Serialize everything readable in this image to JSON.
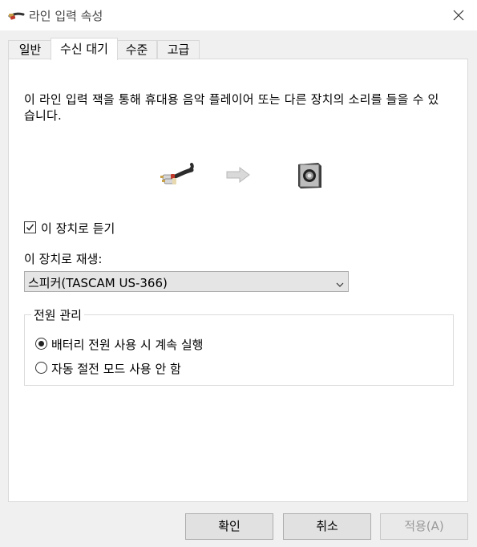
{
  "window": {
    "title": "라인 입력 속성",
    "icon": "line-in-cable-icon",
    "close_icon": "close-icon"
  },
  "tabs": [
    {
      "label": "일반",
      "active": false
    },
    {
      "label": "수신 대기",
      "active": true
    },
    {
      "label": "수준",
      "active": false
    },
    {
      "label": "고급",
      "active": false
    }
  ],
  "listen": {
    "description": "이 라인 입력 잭을 통해 휴대용 음악 플레이어 또는 다른 장치의 소리를 들을 수 있습니다.",
    "checkbox_label": "이 장치로 듣기",
    "checkbox_checked": true,
    "playback_label": "이 장치로 재생:",
    "playback_device": "스피커(TASCAM US-366)",
    "icons": [
      "line-in-cable-icon",
      "arrow-right-icon",
      "speaker-icon"
    ]
  },
  "power": {
    "title": "전원 관리",
    "options": [
      {
        "label": "배터리 전원 사용 시 계속 실행",
        "selected": true
      },
      {
        "label": "자동 절전 모드 사용 안 함",
        "selected": false
      }
    ]
  },
  "buttons": {
    "ok": "확인",
    "cancel": "취소",
    "apply": "적용(A)",
    "apply_enabled": false
  }
}
